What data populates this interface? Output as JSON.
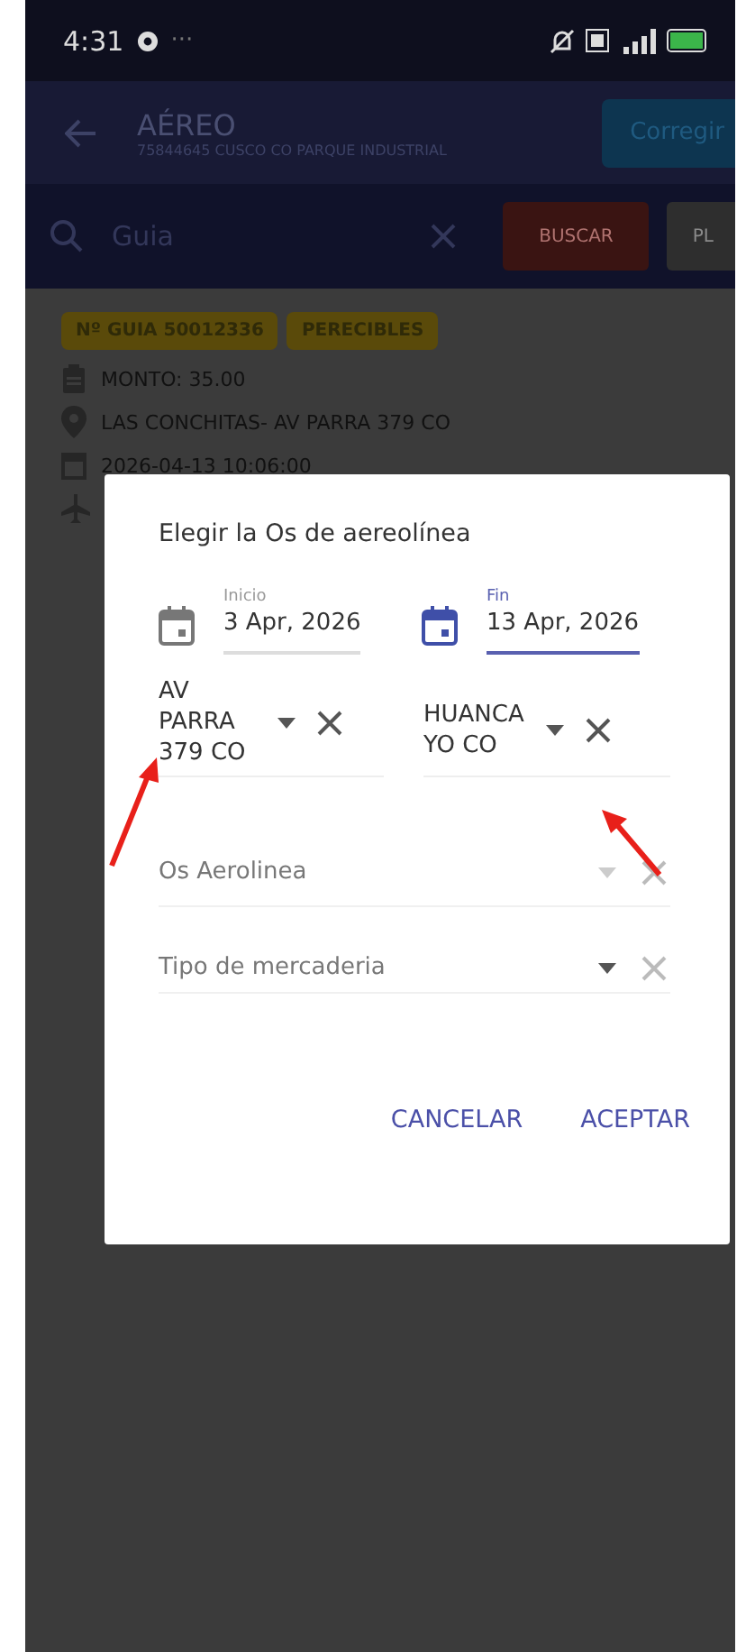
{
  "status_bar": {
    "time": "4:31",
    "more": "···"
  },
  "app_bar": {
    "title": "AÉREO",
    "subtitle": "75844645 CUSCO CO PARQUE INDUSTRIAL",
    "action": "Corregir"
  },
  "search": {
    "placeholder": "Guia",
    "buttons": [
      {
        "label": "BUSCAR",
        "kind": "primary"
      },
      {
        "label": "PL",
        "kind": "secondary"
      }
    ]
  },
  "card": {
    "chips": [
      "Nº GUIA 50012336",
      "PERECIBLES"
    ],
    "rows": [
      {
        "kind": "clipboard",
        "text": "MONTO:  35.00"
      },
      {
        "kind": "pin",
        "text": "LAS CONCHITAS- AV PARRA 379 CO"
      },
      {
        "kind": "calendar",
        "text": "2026-04-13 10:06:00"
      },
      {
        "kind": "plane",
        "text": ""
      }
    ]
  },
  "dialog": {
    "title": "Elegir la Os de aereolínea",
    "dates": [
      {
        "label": "Inicio",
        "value": "3 Apr, 2026",
        "focused": false
      },
      {
        "label": "Fin",
        "value": "13 Apr, 2026",
        "focused": true
      }
    ],
    "origin_selects": [
      {
        "value": "AV PARRA 379 CO"
      },
      {
        "value": "HUANCAYO CO"
      }
    ],
    "selects": [
      {
        "placeholder": "Os Aerolinea",
        "disabled": true
      },
      {
        "placeholder": "Tipo de mercaderia",
        "disabled": false
      }
    ],
    "buttons": [
      "CANCELAR",
      "ACEPTAR"
    ]
  }
}
